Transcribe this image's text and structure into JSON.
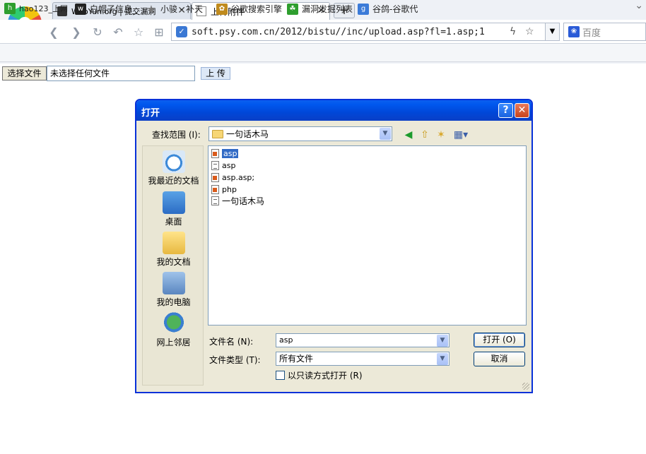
{
  "browser": {
    "tabs": [
      {
        "title": "WooYun.org | 提交漏洞"
      },
      {
        "title": "上传附件"
      }
    ],
    "new_tab": "+",
    "address": "soft.psy.com.cn/2012/bistu//inc/upload.asp?fl=1.asp;1",
    "search_placeholder": "百度",
    "bookmarks": [
      {
        "label": "hao123_上网",
        "icon": "hao123-icon",
        "color": "#2e9e2e"
      },
      {
        "label": "白帽子信息_",
        "icon": "wooyun-icon",
        "color": "#222222"
      },
      {
        "label": "小骏 - 补天",
        "icon": "star-icon",
        "color": "#777777"
      },
      {
        "label": "谷歌搜索引擎",
        "icon": "google-search-icon",
        "color": "#c08b1e"
      },
      {
        "label": "漏洞发掘列表",
        "icon": "bug-icon",
        "color": "#2e9e2e"
      },
      {
        "label": "谷鸽-谷歌代",
        "icon": "google-g-icon",
        "color": "#3b7bd8"
      }
    ]
  },
  "page": {
    "choose_file_label": "选择文件",
    "no_file_text": "未选择任何文件",
    "upload_label": "上 传"
  },
  "dialog": {
    "title": "打开",
    "help_label": "?",
    "close_label": "✕",
    "look_in_label": "查找范围 (I):",
    "look_in_value": "一句话木马",
    "places": [
      {
        "label": "我最近的文档",
        "icon": "recent-documents-icon"
      },
      {
        "label": "桌面",
        "icon": "desktop-icon"
      },
      {
        "label": "我的文档",
        "icon": "my-documents-icon"
      },
      {
        "label": "我的电脑",
        "icon": "my-computer-icon"
      },
      {
        "label": "网上邻居",
        "icon": "network-places-icon"
      }
    ],
    "files": [
      {
        "name": "asp",
        "type": "web",
        "selected": true
      },
      {
        "name": "asp",
        "type": "txt",
        "selected": false
      },
      {
        "name": "asp.asp;",
        "type": "web",
        "selected": false
      },
      {
        "name": "php",
        "type": "web",
        "selected": false
      },
      {
        "name": "一句话木马",
        "type": "txt",
        "selected": false
      }
    ],
    "file_name_label": "文件名 (N):",
    "file_name_value": "asp",
    "file_type_label": "文件类型 (T):",
    "file_type_value": "所有文件",
    "open_label": "打开 (O)",
    "cancel_label": "取消",
    "readonly_label": "以只读方式打开 (R)"
  }
}
